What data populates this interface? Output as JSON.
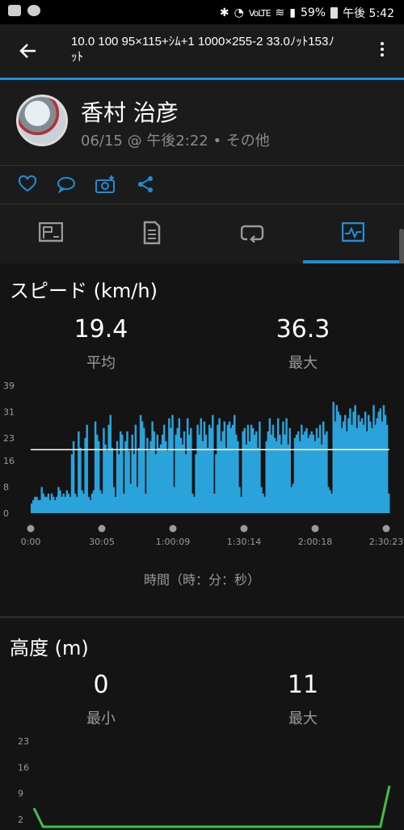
{
  "status_bar": {
    "battery": "59%",
    "time": "午後 5:42",
    "network_tag": "VoLTE"
  },
  "activity": {
    "title": "10.0 100 95×115+ｼﾑ+1 1000×255-2 33.0ﾉｯﾄ153ﾉｯﾄ",
    "user_name": "香村 治彦",
    "meta": "06/15 @ 午後2:22 • その他"
  },
  "tabs": [
    {
      "name": "summary",
      "icon": "map-flag-icon"
    },
    {
      "name": "details",
      "icon": "document-icon"
    },
    {
      "name": "laps",
      "icon": "loop-icon"
    },
    {
      "name": "charts",
      "icon": "chart-icon",
      "active": true
    }
  ],
  "action_icons": [
    "heart-icon",
    "comment-icon",
    "camera-add-icon",
    "share-icon"
  ],
  "speed_section": {
    "title": "スピード (km/h)",
    "avg_value": "19.4",
    "avg_label": "平均",
    "max_value": "36.3",
    "max_label": "最大",
    "xlabel": "時間（時：分：秒）"
  },
  "altitude_section": {
    "title": "高度 (m)",
    "min_value": "0",
    "min_label": "最小",
    "max_value": "11",
    "max_label": "最大"
  },
  "colors": {
    "accent": "#1e8fd6",
    "speed_bar": "#2aa3db",
    "altitude_line": "#3ec04b"
  },
  "chart_data": [
    {
      "type": "bar",
      "title": "スピード (km/h)",
      "xlabel": "時間（時：分：秒）",
      "ylabel": "",
      "yticks": [
        "0",
        "8",
        "16",
        "23",
        "31",
        "39"
      ],
      "xticks": [
        "0:00",
        "30:05",
        "1:00:09",
        "1:30:14",
        "2:00:18",
        "2:30:23"
      ],
      "ylim": [
        0,
        39
      ],
      "x_total_seconds": 9023,
      "average_line": 19.4,
      "values": [
        3,
        4,
        5,
        5,
        4,
        4,
        8,
        6,
        5,
        5,
        6,
        4,
        6,
        5,
        4,
        5,
        8,
        7,
        5,
        6,
        5,
        7,
        6,
        5,
        18,
        22,
        6,
        5,
        25,
        20,
        7,
        6,
        23,
        27,
        5,
        4,
        6,
        7,
        28,
        24,
        22,
        7,
        6,
        26,
        21,
        19,
        27,
        30,
        20,
        8,
        5,
        22,
        18,
        25,
        24,
        6,
        22,
        25,
        19,
        9,
        24,
        18,
        27,
        8,
        20,
        30,
        28,
        26,
        6,
        23,
        19,
        22,
        28,
        25,
        18,
        24,
        20,
        21,
        24,
        27,
        22,
        19,
        29,
        26,
        30,
        8,
        24,
        26,
        29,
        23,
        21,
        25,
        18,
        29,
        24,
        26,
        6,
        5,
        18,
        27,
        24,
        29,
        22,
        28,
        24,
        20,
        27,
        26,
        30,
        6,
        18,
        27,
        29,
        22,
        25,
        28,
        20,
        27,
        28,
        26,
        27,
        30,
        24,
        22,
        8,
        5,
        25,
        26,
        21,
        27,
        22,
        27,
        26,
        24,
        25,
        20,
        28,
        8,
        6,
        5,
        22,
        25,
        29,
        24,
        27,
        23,
        22,
        29,
        24,
        21,
        28,
        24,
        29,
        21,
        26,
        8,
        9,
        23,
        24,
        25,
        22,
        27,
        24,
        25,
        26,
        23,
        24,
        25,
        24,
        22,
        26,
        23,
        27,
        21,
        28,
        24,
        25,
        8,
        7,
        6,
        34,
        28,
        33,
        31,
        30,
        26,
        28,
        30,
        25,
        29,
        32,
        27,
        31,
        33,
        26,
        30,
        28,
        29,
        27,
        31,
        25,
        30,
        28,
        26,
        33,
        27,
        29,
        31,
        32,
        28,
        33,
        30,
        27,
        6
      ]
    },
    {
      "type": "line",
      "title": "高度 (m)",
      "yticks": [
        "2",
        "9",
        "16",
        "23"
      ],
      "ylim": [
        0,
        23
      ],
      "values": [
        5,
        0,
        0,
        0,
        0,
        0,
        0,
        0,
        0,
        0,
        0,
        0,
        0,
        0,
        0,
        0,
        0,
        0,
        0,
        0,
        0,
        0,
        0,
        0,
        0,
        0,
        0,
        0,
        0,
        0,
        0,
        0,
        0,
        0,
        0,
        0,
        0,
        0,
        0,
        11
      ]
    }
  ]
}
